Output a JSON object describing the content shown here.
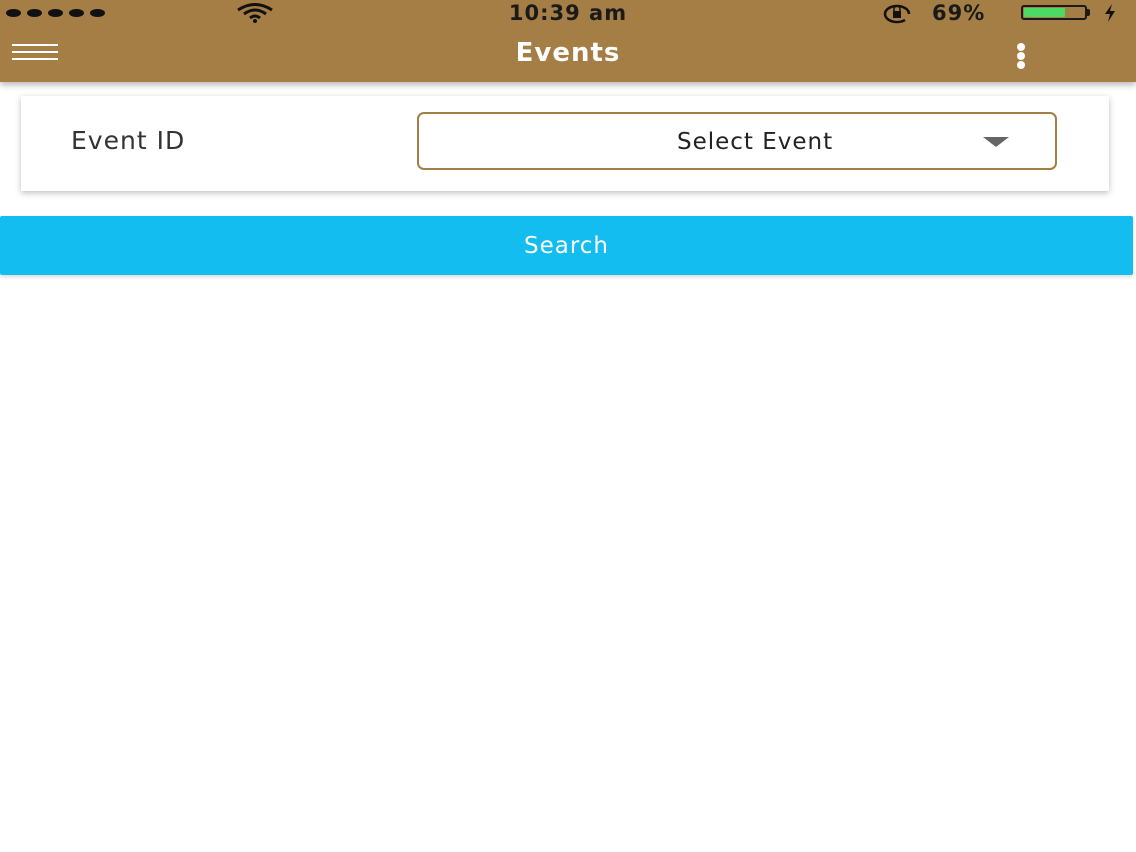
{
  "status_bar": {
    "time": "10:39 am",
    "battery_percent": "69%",
    "battery_level": 0.69,
    "battery_color": "#4cd964"
  },
  "header": {
    "title": "Events",
    "background": "#a47e44",
    "menu_icon": "hamburger-menu-icon",
    "more_icon": "vertical-ellipsis-icon"
  },
  "form": {
    "event_id_label": "Event ID",
    "event_select_value": "Select Event"
  },
  "search_button": {
    "label": "Search",
    "color": "#14bdf0"
  }
}
